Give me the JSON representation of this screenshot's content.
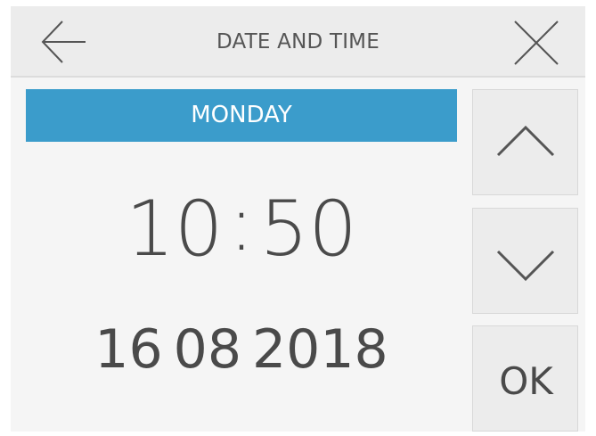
{
  "header": {
    "title": "DATE AND TIME",
    "back_icon": "arrow-left-icon",
    "close_icon": "close-icon"
  },
  "day": {
    "label": "MONDAY",
    "color": "#3b9ccb"
  },
  "time": {
    "hours": "10",
    "separator": ":",
    "minutes": "50"
  },
  "date": {
    "day": "16",
    "month": "08",
    "year": "2018"
  },
  "controls": {
    "up_icon": "chevron-up-icon",
    "down_icon": "chevron-down-icon",
    "ok_label": "OK"
  }
}
